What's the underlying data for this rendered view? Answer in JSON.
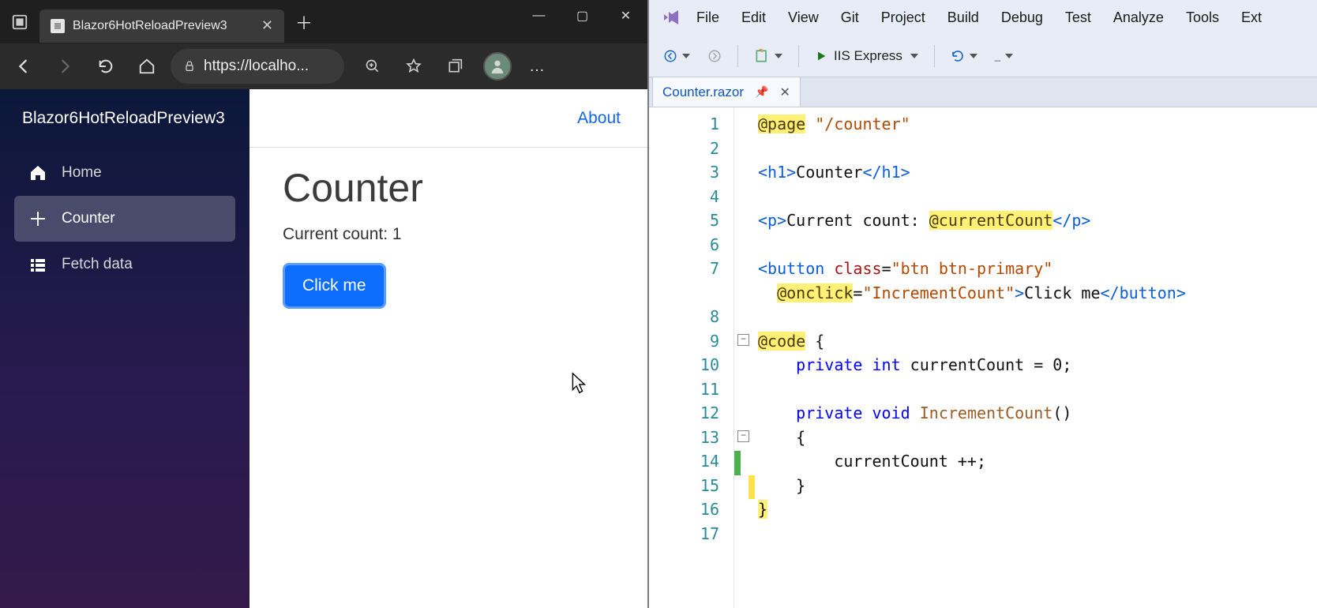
{
  "browser": {
    "tab_title": "Blazor6HotReloadPreview3",
    "url_display": "https://localho...",
    "nav": {
      "brand": "Blazor6HotReloadPreview3",
      "items": [
        {
          "icon": "home",
          "label": "Home"
        },
        {
          "icon": "plus",
          "label": "Counter"
        },
        {
          "icon": "list",
          "label": "Fetch data"
        }
      ],
      "active_index": 1
    },
    "topbar": {
      "about": "About"
    },
    "page": {
      "heading": "Counter",
      "count_label": "Current count: ",
      "count_value": "1",
      "button": "Click me"
    }
  },
  "vs": {
    "menus": [
      "File",
      "Edit",
      "View",
      "Git",
      "Project",
      "Build",
      "Debug",
      "Test",
      "Analyze",
      "Tools",
      "Ext"
    ],
    "toolbar": {
      "run_profile": "IIS Express"
    },
    "tab": "Counter.razor",
    "code_lines": [
      {
        "n": 1,
        "html": "<span class='hl-dir'>@page</span> <span class='str'>\"/counter\"</span>"
      },
      {
        "n": 2,
        "html": ""
      },
      {
        "n": 3,
        "html": "<span class='blue'>&lt;h1&gt;</span>Counter<span class='blue'>&lt;/h1&gt;</span>"
      },
      {
        "n": 4,
        "html": ""
      },
      {
        "n": 5,
        "html": "<span class='blue'>&lt;p&gt;</span>Current count: <span class='hl-dir'>@currentCount</span><span class='blue'>&lt;/p&gt;</span>"
      },
      {
        "n": 6,
        "html": ""
      },
      {
        "n": 7,
        "html": "<span class='blue'>&lt;button</span> <span class='maroon'>class</span>=<span class='str'>\"btn btn-primary\"</span>"
      },
      {
        "n": "",
        "html": "  <span class='hl-dir'>@onclick</span>=<span class='str'>\"IncrementCount\"</span><span class='blue'>&gt;</span>Click me<span class='blue'>&lt;/button&gt;</span>"
      },
      {
        "n": 8,
        "html": ""
      },
      {
        "n": 9,
        "html": "<span class='hl-dir'>@code</span> <span class='sym'>{</span>"
      },
      {
        "n": 10,
        "html": "    <span class='kw'>private</span> <span class='kw'>int</span> currentCount = 0;"
      },
      {
        "n": 11,
        "html": ""
      },
      {
        "n": 12,
        "html": "    <span class='kw'>private</span> <span class='kw'>void</span> <span class='brown'>IncrementCount</span>()"
      },
      {
        "n": 13,
        "html": "    {"
      },
      {
        "n": 14,
        "html": "        currentCount ++;"
      },
      {
        "n": 15,
        "html": "    }"
      },
      {
        "n": 16,
        "html": "<span class='y-end'>}</span>"
      },
      {
        "n": 17,
        "html": ""
      }
    ]
  }
}
